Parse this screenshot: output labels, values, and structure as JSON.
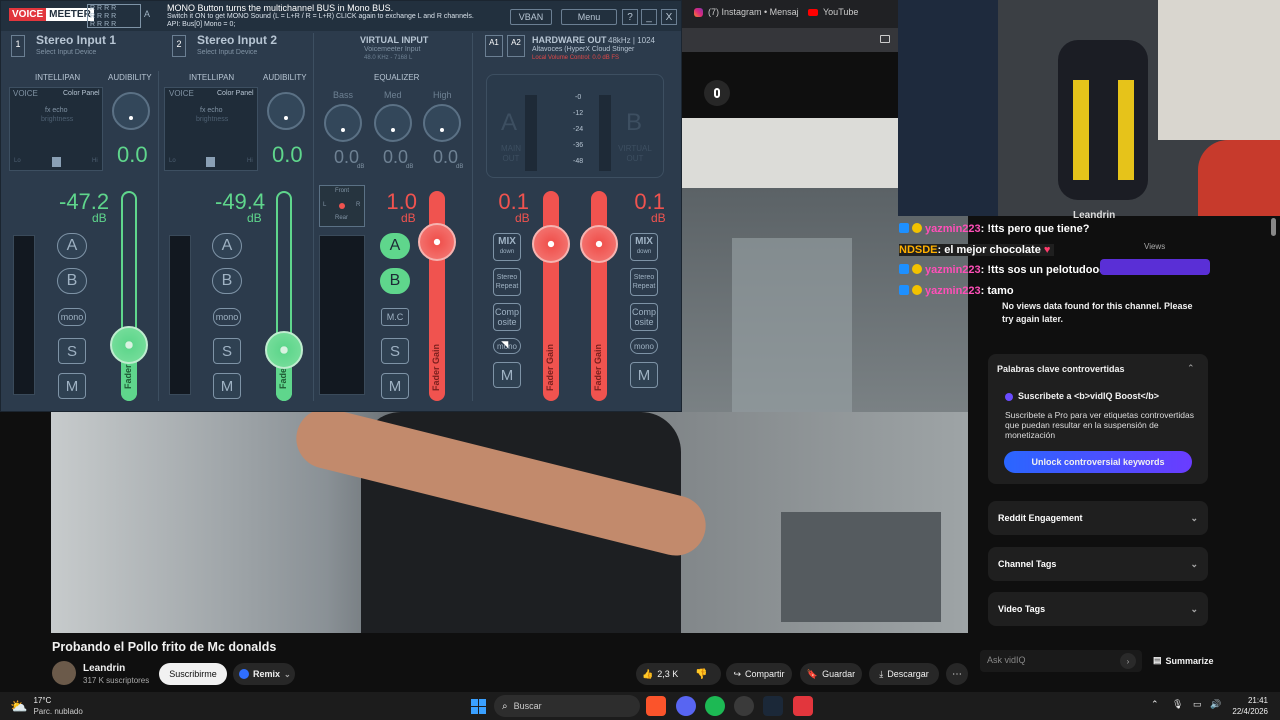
{
  "browser": {
    "tabs": [
      {
        "icon": "instagram-icon",
        "label": "(7) Instagram • Mensaj"
      },
      {
        "icon": "youtube-icon",
        "label": "YouTube"
      }
    ]
  },
  "video": {
    "title": "Probando el Pollo frito de Mc donalds",
    "channel": "Leandrin",
    "subscribers": "317 K suscriptores",
    "subscribe_label": "Suscribirme",
    "remix_label": "Remix",
    "likes": "2,3 K",
    "share_label": "Compartir",
    "save_label": "Guardar",
    "download_label": "Descargar"
  },
  "webcam": {
    "overlay_name": "Leandrin"
  },
  "chat": [
    {
      "user": "yazmin223",
      "message": ": !tts pero que tiene?",
      "user_color": "#ff4fb8"
    },
    {
      "user": "NDSDE",
      "message": ": el mejor chocolate",
      "user_color": "#ffb000"
    },
    {
      "user": "yazmin223",
      "message": ": !tts sos un pelotudoooo!",
      "user_color": "#ff4fb8"
    },
    {
      "user": "yazmin223",
      "message": ": tamo",
      "user_color": "#ff4fb8"
    }
  ],
  "vidiq": {
    "views_header": "Views",
    "no_views": "No views data found for this channel. Please try again later.",
    "controversial_title": "Palabras clave controvertidas",
    "boost_title": "Suscribete a <b>vidIQ Boost</b>",
    "boost_desc": "Suscribete a Pro para ver etiquetas controvertidas que puedan resultar en la suspensión de monetización",
    "unlock_label": "Unlock controversial keywords",
    "reddit_label": "Reddit Engagement",
    "channel_tags_label": "Channel Tags",
    "video_tags_label": "Video Tags",
    "ask_placeholder": "Ask vidIQ",
    "summarize_label": "Summarize"
  },
  "voicemeeter": {
    "logo_voice": "VOICE",
    "logo_meeter": "MEETER",
    "info_line1": "MONO Button turns the multichannel BUS in Mono BUS.",
    "info_line2": "Switch it ON to get MONO Sound (L = L+R / R = L+R) CLICK again to exchange L and R channels.",
    "info_line3": "API: Bus[0] Mono = 0;",
    "vban_label": "VBAN",
    "menu_label": "Menu",
    "help_label": "?",
    "min_label": "_",
    "close_label": "X",
    "strip1": {
      "num": "1",
      "name": "Stereo Input 1",
      "sub": "Select Input Device",
      "db": "-47.2",
      "db_unit": "dB",
      "knob_val": "0.0"
    },
    "strip2": {
      "num": "2",
      "name": "Stereo Input 2",
      "sub": "Select Input Device",
      "db": "-49.4",
      "db_unit": "dB",
      "knob_val": "0.0"
    },
    "virtual": {
      "name": "VIRTUAL INPUT",
      "sub": "Voicemeeter Input",
      "rate": "48.0 KHz - 7168 L",
      "db": "1.0",
      "db_unit": "dB",
      "eq_label": "EQUALIZER",
      "bass": "Bass",
      "med": "Med",
      "high": "High",
      "bass_val": "0.0",
      "med_val": "0.0",
      "high_val": "0.0",
      "eq_unit": "dB"
    },
    "hw": {
      "a1": "A1",
      "a2": "A2",
      "name": "HARDWARE OUT",
      "rate": "48kHz | 1024",
      "device": "Altavoces (HyperX Cloud Stinger",
      "warn": "Local Volume Control: 0.0 dB FS"
    },
    "intellipan": "INTELLIPAN",
    "audibility": "AUDIBILITY",
    "voice": "VOICE",
    "color_panel": "Color Panel",
    "fx_echo": "fx echo",
    "brightness": "brightness",
    "lo": "Lo",
    "hi": "Hi",
    "front": "Front",
    "rear": "Rear",
    "L": "L",
    "R": "R",
    "meter_marks": [
      "-0",
      "-12",
      "-24",
      "-36",
      "-48"
    ],
    "main_out": "MAIN OUT",
    "virtual_out": "VIRTUAL OUT",
    "A": "A",
    "B": "B",
    "mono": "mono",
    "solo": "S",
    "mute": "M",
    "mc": "M.C",
    "fader": "Fader",
    "fader_gain": "Fader Gain",
    "mix_down": "MIX",
    "down": "down",
    "stereo": "Stereo",
    "repeat": "Repeat",
    "comp": "Comp",
    "osite": "osite",
    "bus_db1": "0.1",
    "bus_db2": "0.1",
    "colors": {
      "green": "#5fd68c",
      "red": "#f0534f",
      "bg": "#2c3b4c"
    }
  },
  "taskbar": {
    "weather_temp": "17°C",
    "weather_desc": "Parc. nublado",
    "search_label": "Buscar",
    "time": "21:41",
    "date": "22/4/2026"
  }
}
